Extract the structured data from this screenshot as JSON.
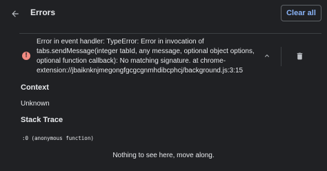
{
  "header": {
    "back_icon": "arrow-back-icon",
    "title": "Errors",
    "clear_all_label": "Clear all"
  },
  "error_entry": {
    "status_icon": "error-circle-icon",
    "message": "Error in event handler: TypeError: Error in invocation of tabs.sendMessage(integer tabId, any message, optional object options, optional function callback): No matching signature. at chrome-extension://jbaiknknjmegongfgcgcgnmhdibcphcj/background.js:3:15",
    "collapse_icon": "chevron-up-icon",
    "delete_icon": "trash-icon"
  },
  "details": {
    "context_label": "Context",
    "context_value": "Unknown",
    "stack_trace_label": "Stack Trace",
    "stack_trace_line": ":0 (anonymous function)",
    "empty_message": "Nothing to see here, move along."
  },
  "colors": {
    "background": "#202124",
    "text": "#e8eaed",
    "accent": "#8ab4f8",
    "error": "#f28b82",
    "border": "#5f6368"
  }
}
